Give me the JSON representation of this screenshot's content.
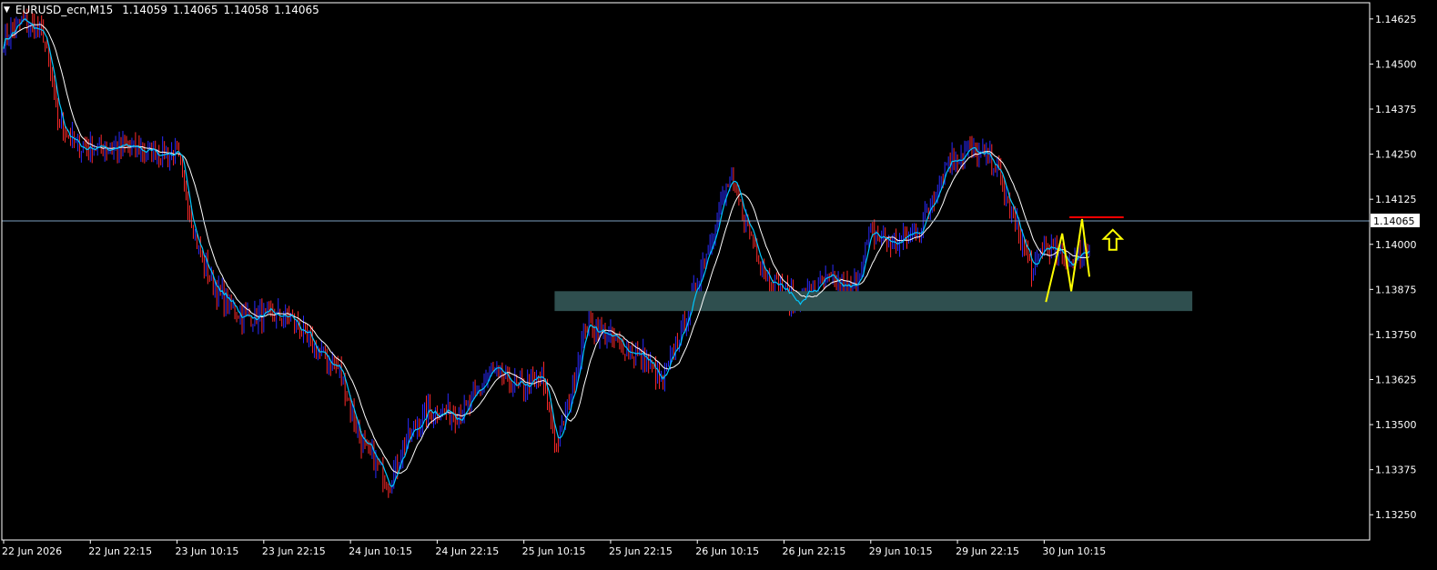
{
  "header": {
    "symbol": "EURUSD_ecn,M15",
    "open": "1.14059",
    "high": "1.14065",
    "low": "1.14058",
    "close": "1.14065"
  },
  "colors": {
    "background": "#000000",
    "frame": "#ffffff",
    "bull_candle": "#2a2aff",
    "bear_candle": "#ff2a2a",
    "fast_ma": "#00c8ff",
    "slow_ma": "#ffffff",
    "zone": "#2f4f4f",
    "bid_line": "#7d9fbf",
    "annotation": "#ffff00",
    "resistance": "#ff0000"
  },
  "chart_data": {
    "type": "line",
    "title": "EURUSD_ecn,M15",
    "current_price": "1.14065",
    "y_range": [
      1.1318,
      1.1467
    ],
    "y_ticks": [
      "1.14625",
      "1.14500",
      "1.14375",
      "1.14250",
      "1.14125",
      "1.14000",
      "1.13875",
      "1.13750",
      "1.13625",
      "1.13500",
      "1.13375",
      "1.13250"
    ],
    "x_ticks": [
      "22 Jun 2026",
      "22 Jun 22:15",
      "23 Jun 10:15",
      "23 Jun 22:15",
      "24 Jun 10:15",
      "24 Jun 22:15",
      "25 Jun 10:15",
      "25 Jun 22:15",
      "26 Jun 10:15",
      "26 Jun 22:15",
      "29 Jun 10:15",
      "29 Jun 22:15",
      "30 Jun 10:15"
    ],
    "x_ticks_bar_index": [
      0,
      48,
      96,
      144,
      192,
      240,
      288,
      336,
      384,
      432,
      480,
      528,
      576
    ],
    "bars_count": 602,
    "price_path": [
      [
        0,
        1.1457
      ],
      [
        10,
        1.1462
      ],
      [
        22,
        1.1458
      ],
      [
        30,
        1.1435
      ],
      [
        40,
        1.1427
      ],
      [
        60,
        1.1427
      ],
      [
        80,
        1.1426
      ],
      [
        96,
        1.1425
      ],
      [
        108,
        1.1398
      ],
      [
        118,
        1.1387
      ],
      [
        132,
        1.138
      ],
      [
        158,
        1.138
      ],
      [
        172,
        1.1371
      ],
      [
        186,
        1.1365
      ],
      [
        198,
        1.1345
      ],
      [
        214,
        1.1334
      ],
      [
        222,
        1.1345
      ],
      [
        235,
        1.1354
      ],
      [
        255,
        1.1353
      ],
      [
        270,
        1.1365
      ],
      [
        285,
        1.136
      ],
      [
        298,
        1.1363
      ],
      [
        306,
        1.1344
      ],
      [
        314,
        1.1358
      ],
      [
        322,
        1.1378
      ],
      [
        330,
        1.1376
      ],
      [
        342,
        1.1372
      ],
      [
        356,
        1.1368
      ],
      [
        364,
        1.1361
      ],
      [
        378,
        1.138
      ],
      [
        392,
        1.1403
      ],
      [
        402,
        1.1418
      ],
      [
        412,
        1.1405
      ],
      [
        422,
        1.1392
      ],
      [
        438,
        1.1384
      ],
      [
        456,
        1.139
      ],
      [
        470,
        1.1387
      ],
      [
        480,
        1.1403
      ],
      [
        494,
        1.14
      ],
      [
        508,
        1.1405
      ],
      [
        522,
        1.1423
      ],
      [
        534,
        1.1426
      ],
      [
        548,
        1.1423
      ],
      [
        560,
        1.1406
      ],
      [
        570,
        1.1392
      ],
      [
        576,
        1.14
      ],
      [
        590,
        1.1395
      ],
      [
        602,
        1.14
      ]
    ],
    "series": [
      {
        "values_ref": "price_path",
        "color": "#00c8ff"
      },
      {
        "values_ref": "price_path_smoothed",
        "color": "#ffffff"
      }
    ],
    "zone": {
      "from_bar": 305,
      "to_bar": 658,
      "low": 1.13815,
      "high": 1.1387
    },
    "current_price_value": 1.14065,
    "resistance": {
      "from_bar": 590,
      "to_bar": 620,
      "price": 1.14075
    },
    "pattern": [
      [
        577,
        1.1384
      ],
      [
        586,
        1.1403
      ],
      [
        591,
        1.1387
      ],
      [
        597,
        1.1407
      ],
      [
        601,
        1.1391
      ]
    ],
    "arrow": {
      "bar": 614,
      "price": 1.1401,
      "direction": "up"
    }
  }
}
